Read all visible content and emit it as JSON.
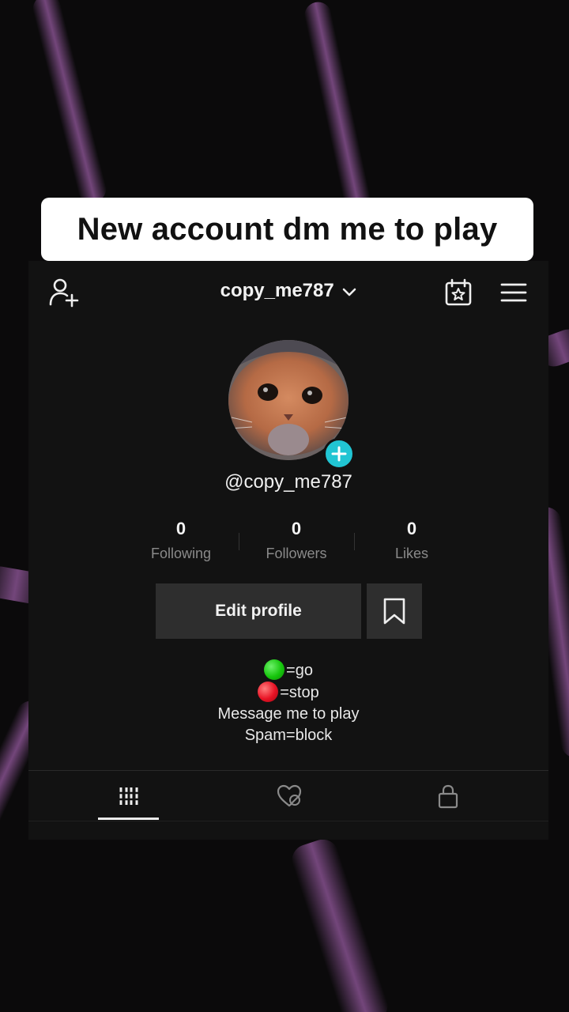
{
  "caption": "New account dm me to play",
  "header": {
    "username": "copy_me787",
    "icons": [
      "add-user-icon",
      "chevron-down-icon",
      "calendar-star-icon",
      "menu-icon"
    ]
  },
  "profile": {
    "handle": "@copy_me787",
    "avatar_icon": "cat-photo",
    "add_badge_icon": "plus-icon"
  },
  "stats": [
    {
      "value": "0",
      "label": "Following"
    },
    {
      "value": "0",
      "label": "Followers"
    },
    {
      "value": "0",
      "label": "Likes"
    }
  ],
  "actions": {
    "edit_profile": "Edit profile",
    "bookmark_icon": "bookmark-icon"
  },
  "bio": {
    "line1": "=go",
    "line2": "=stop",
    "line3": "Message me to play",
    "line4": "Spam=block",
    "green": "#16c60c",
    "red": "#e81224"
  },
  "tabs": [
    {
      "icon": "grid-videos-icon",
      "active": true
    },
    {
      "icon": "liked-hidden-icon",
      "active": false
    },
    {
      "icon": "lock-icon",
      "active": false
    }
  ],
  "colors": {
    "accent": "#21c5d3",
    "panel": "#121212"
  }
}
